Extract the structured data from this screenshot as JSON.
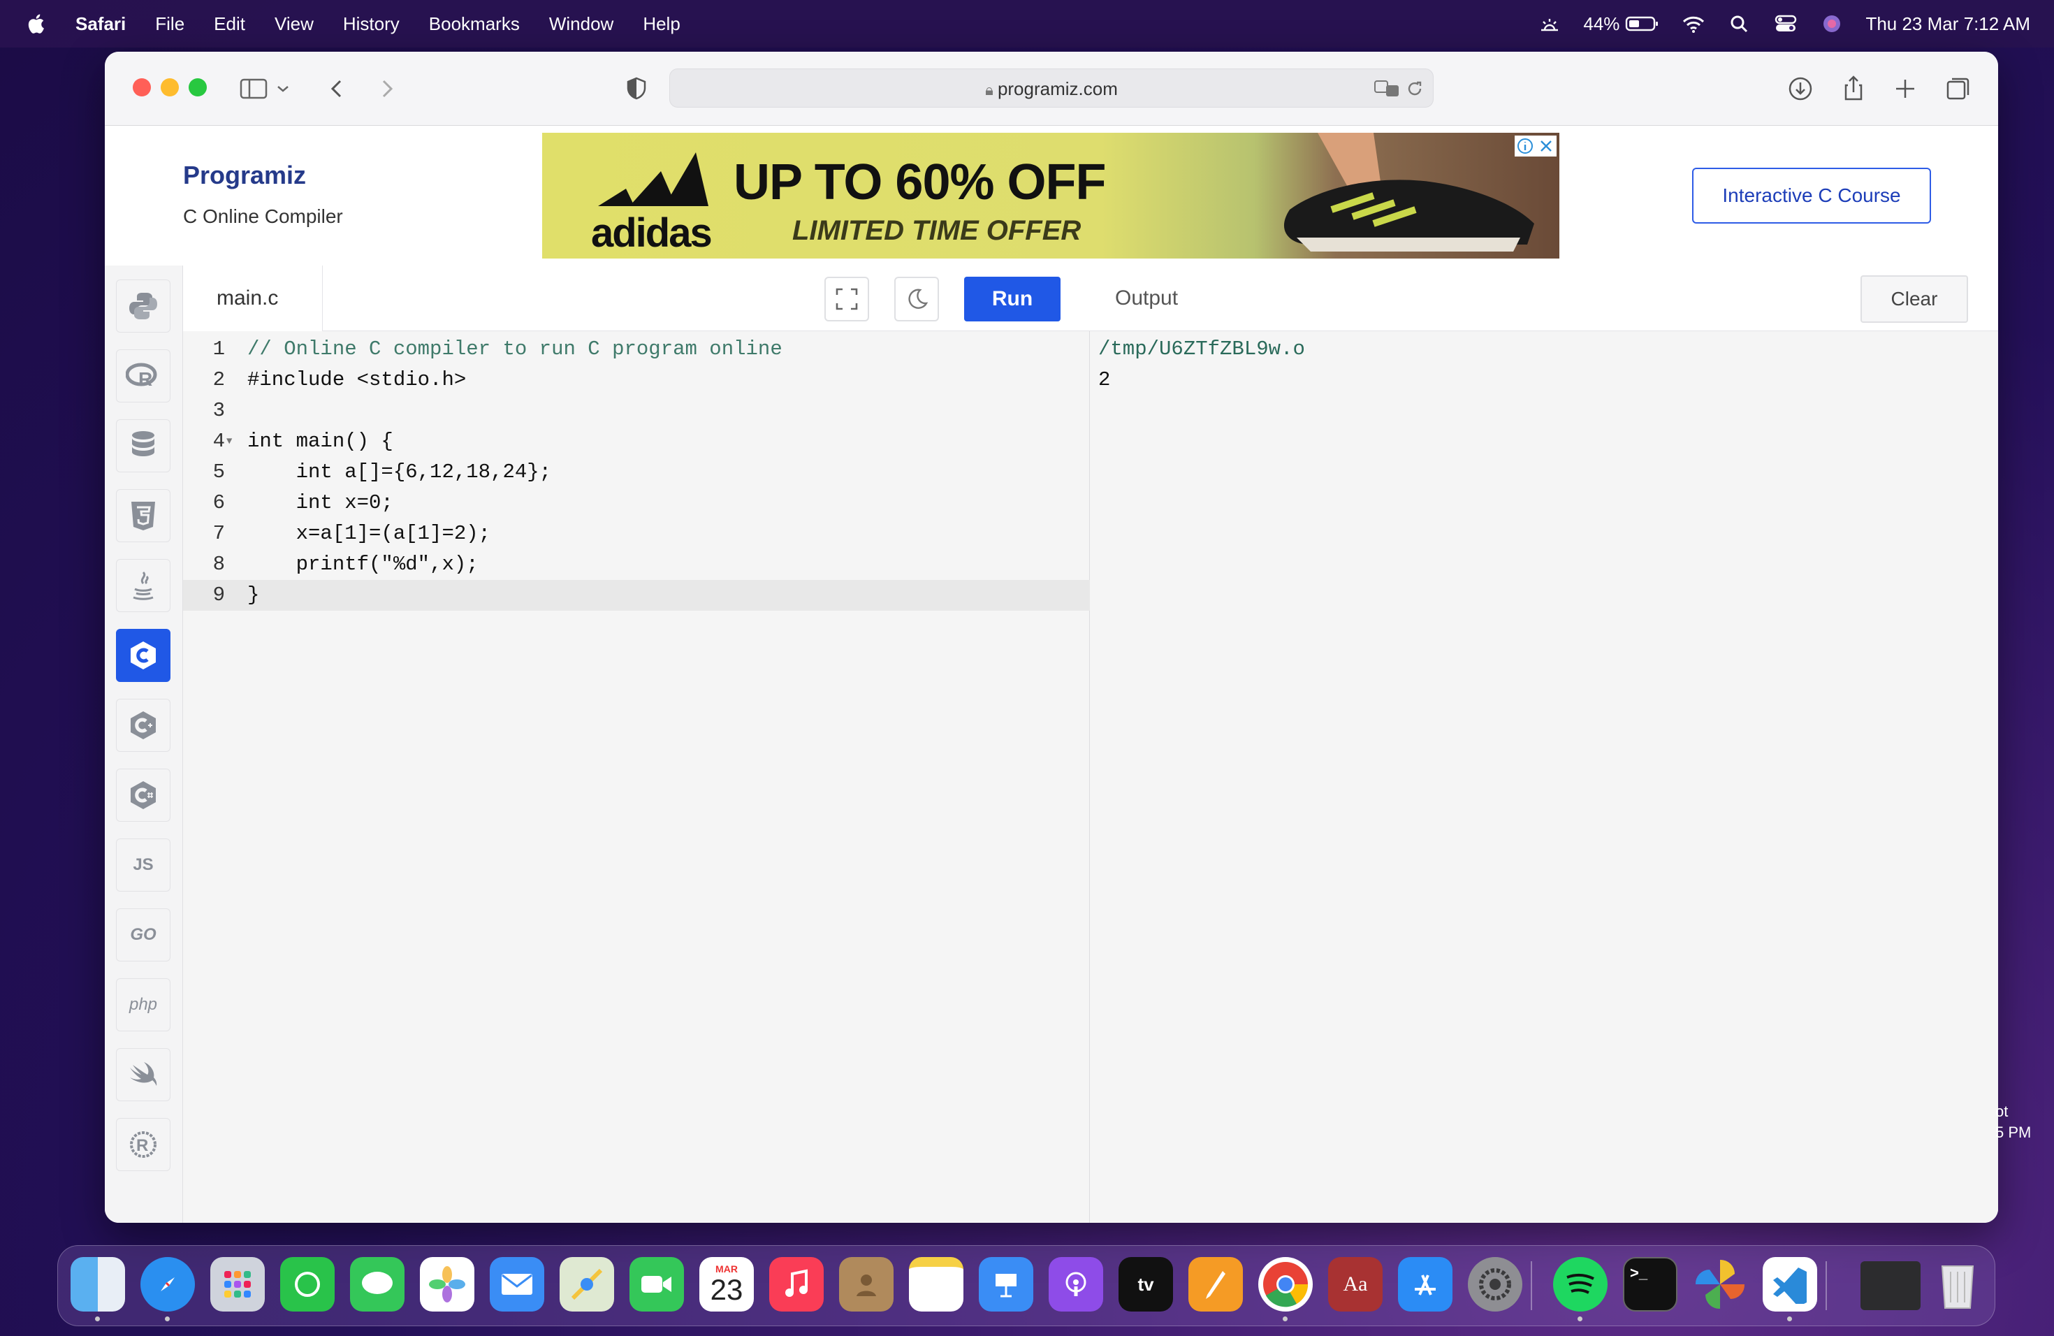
{
  "menubar": {
    "app": "Safari",
    "items": [
      "File",
      "Edit",
      "View",
      "History",
      "Bookmarks",
      "Window",
      "Help"
    ],
    "battery": "44%",
    "datetime": "Thu 23 Mar  7:12 AM"
  },
  "browser": {
    "url": "programiz.com"
  },
  "header": {
    "logo": "Programiz",
    "subtitle": "C Online Compiler",
    "course_button": "Interactive C Course"
  },
  "ad": {
    "brand": "adidas",
    "headline": "UP TO 60% OFF",
    "subline": "LIMITED TIME OFFER"
  },
  "languages": [
    "python-icon",
    "r-icon",
    "sql-icon",
    "html5-icon",
    "java-icon",
    "c-icon",
    "cpp-icon",
    "csharp-icon",
    "js-icon",
    "go-icon",
    "php-icon",
    "swift-icon",
    "rust-icon"
  ],
  "language_labels": {
    "js": "JS",
    "go": "GO",
    "php": "php"
  },
  "editor": {
    "tab": "main.c",
    "run_label": "Run",
    "lines": [
      {
        "n": "1",
        "text": "// Online C compiler to run C program online"
      },
      {
        "n": "2",
        "text": "#include <stdio.h>"
      },
      {
        "n": "3",
        "text": ""
      },
      {
        "n": "4",
        "text": "int main() {"
      },
      {
        "n": "5",
        "text": "    int a[]={6,12,18,24};"
      },
      {
        "n": "6",
        "text": "    int x=0;"
      },
      {
        "n": "7",
        "text": "    x=a[1]=(a[1]=2);"
      },
      {
        "n": "8",
        "text": "    printf(\"%d\",x);"
      },
      {
        "n": "9",
        "text": "}"
      }
    ]
  },
  "output": {
    "title": "Output",
    "clear_label": "Clear",
    "lines": [
      "/tmp/U6ZTfZBL9w.o",
      "2"
    ]
  },
  "side_note": {
    "line1": "ot",
    "line2": "5 PM"
  },
  "dock": {
    "calendar_month": "MAR",
    "calendar_day": "23",
    "apps": [
      "finder-icon",
      "safari-icon",
      "launchpad-icon",
      "whatsapp-icon",
      "messages-icon",
      "photos-icon",
      "mail-icon",
      "maps-icon",
      "facetime-icon",
      "calendar-icon",
      "music-icon",
      "contacts-icon",
      "notes-icon",
      "keynote-icon",
      "podcasts-icon",
      "appletv-icon",
      "pages-icon",
      "chrome-icon",
      "dictionary-icon",
      "appstore-icon",
      "settings-icon",
      "spotify-icon",
      "terminal-icon",
      "pinwheel-icon",
      "vscode-icon",
      "window-thumb-icon",
      "trash-icon"
    ]
  }
}
